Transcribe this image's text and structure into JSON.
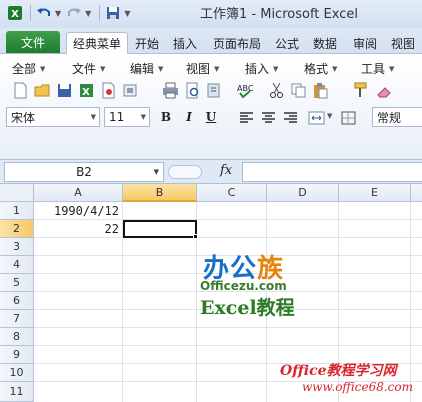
{
  "window": {
    "title": "工作簿1 - Microsoft Excel"
  },
  "tabs": {
    "file": "文件",
    "items": [
      "经典菜单",
      "开始",
      "插入",
      "页面布局",
      "公式",
      "数据",
      "审阅",
      "视图"
    ],
    "active": "经典菜单"
  },
  "classic_menu": [
    "全部",
    "文件",
    "编辑",
    "视图",
    "插入",
    "格式",
    "工具"
  ],
  "font": {
    "name": "宋体",
    "size": "11",
    "bold": "B",
    "italic": "I",
    "underline": "U"
  },
  "number_format": "常规",
  "formula_bar": {
    "name_box": "B2",
    "fx": "fx",
    "content": ""
  },
  "columns": [
    "A",
    "B",
    "C",
    "D",
    "E"
  ],
  "selected_column": "B",
  "rows": [
    "1",
    "2",
    "3",
    "4",
    "5",
    "6",
    "7",
    "8",
    "9",
    "10",
    "11"
  ],
  "selected_row": "2",
  "cells": {
    "A1": "1990/4/12",
    "A2": "22"
  },
  "watermark": {
    "logo_blue": "办公",
    "logo_orange": "族",
    "domain": "Officezu.com",
    "excel": "Excel教程",
    "site": "Office教程学习网",
    "url": "www.office68.com"
  },
  "colors": {
    "file_tab": "#1f7a2e",
    "selection": "#f7c966",
    "watermark_blue": "#1c6fc7",
    "watermark_red": "#d9262c"
  }
}
